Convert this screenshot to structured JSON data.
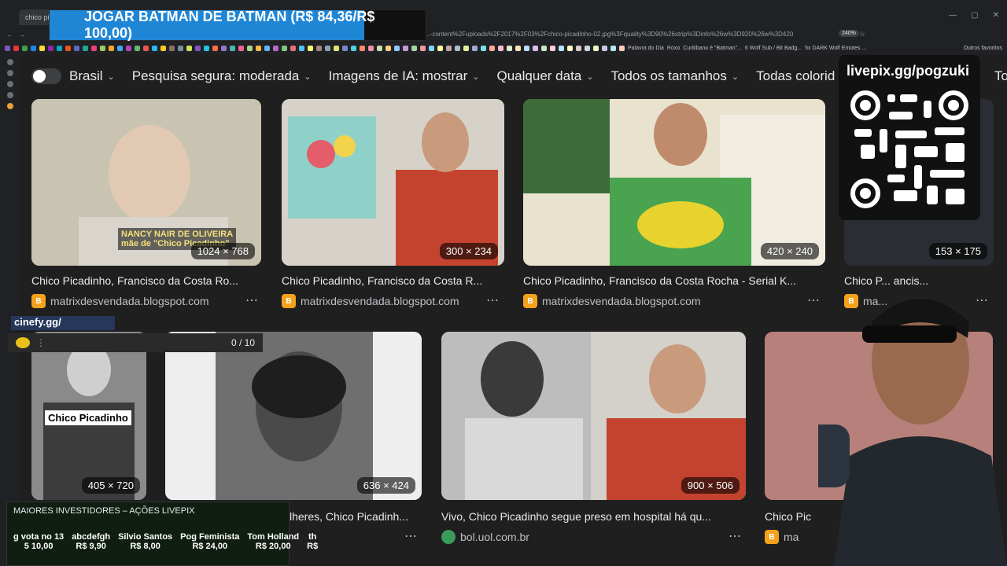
{
  "browser": {
    "tab_title": "chico picadinho",
    "url": "...-content%2Fuploads%2F2017%2F03%2Fchico-picadinho-02.jpg%3Fquality%3D90%26strip%3Dinfo%26w%3D920%26w%3D420",
    "zoom": "240%",
    "bookmarks": [
      "Palavra do Dia",
      "Roxo",
      "Curitibano é \"Batman\"...",
      "6 Wolf Sub / Bit Badg...",
      "5x DARK Wolf Emotes ...",
      "Outros favoritos"
    ]
  },
  "banner": {
    "text": "JOGAR BATMAN DE BATMAN (R$ 84,36/R$ 100,00)"
  },
  "filters": {
    "region": "Brasil",
    "safe_search": "Pesquisa segura: moderada",
    "ai_images": "Imagens de IA: mostrar",
    "date": "Qualquer data",
    "sizes": "Todos os tamanhos",
    "colors": "Todas colorid",
    "more": "To"
  },
  "results_row1": [
    {
      "title": "Chico Picadinho, Francisco da Costa Ro...",
      "source": "matrixdesvendada.blogspot.com",
      "size": "1024 × 768"
    },
    {
      "title": "Chico Picadinho, Francisco da Costa R...",
      "source": "matrixdesvendada.blogspot.com",
      "size": "300 × 234"
    },
    {
      "title": "Chico Picadinho, Francisco da Costa Rocha - Serial K...",
      "source": "matrixdesvendada.blogspot.com",
      "size": "420 × 240"
    },
    {
      "title": "Chico P... ancis...",
      "source": "ma...",
      "size": "153 × 175"
    }
  ],
  "results_row2": [
    {
      "title": "",
      "source": "",
      "size": "405 × 720",
      "overlay": "Chico Picadinho"
    },
    {
      "title": "lheres, Chico Picadinh...",
      "source": "",
      "size": "636 × 424"
    },
    {
      "title": "Vivo, Chico Picadinho segue preso em hospital há qu...",
      "source": "bol.uol.com.br",
      "size": "900 × 506"
    },
    {
      "title": "Chico Pic",
      "source": "ma",
      "size": ""
    }
  ],
  "image_overlay_1": {
    "line1": "NANCY NAIR DE OLIVEIRA",
    "line2": "mãe de \"Chico Picadinho\""
  },
  "qr": {
    "title": "livepix.gg/pogzuki"
  },
  "cinefy": {
    "label": "cinefy.gg/",
    "progress": "0 / 10",
    "progress_fraction": 0
  },
  "investors": {
    "title": "MAIORES INVESTIDORES – AÇÕES LIVEPIX",
    "items": [
      {
        "name": "g vota no 13",
        "amount": "5 10,00"
      },
      {
        "name": "abcdefgh",
        "amount": "R$ 9,90"
      },
      {
        "name": "Silvio Santos",
        "amount": "R$ 8,00"
      },
      {
        "name": "Pog Feminista",
        "amount": "R$ 24,00"
      },
      {
        "name": "Tom Holland",
        "amount": "R$ 20,00"
      },
      {
        "name": "th",
        "amount": "R$"
      }
    ]
  }
}
